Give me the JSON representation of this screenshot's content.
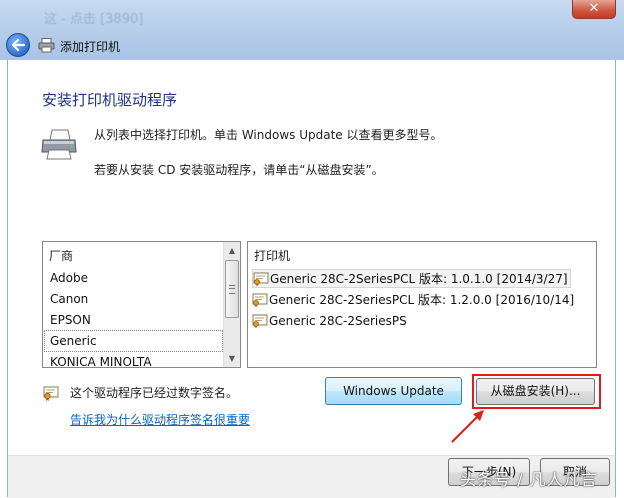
{
  "window": {
    "blurred_title": "这 - 点击 [3890]",
    "title": "添加打印机",
    "close_glyph": "✕"
  },
  "page": {
    "heading": "安装打印机驱动程序",
    "instruction_1": "从列表中选择打印机。单击 Windows Update 以查看更多型号。",
    "instruction_2": "若要从安装 CD 安装驱动程序，请单击“从磁盘安装”。"
  },
  "manufacturer_list": {
    "header": "厂商",
    "items": [
      "Adobe",
      "Canon",
      "EPSON",
      "Generic",
      "KONICA MINOLTA"
    ],
    "selected": "Generic"
  },
  "printer_list": {
    "header": "打印机",
    "items": [
      "Generic 28C-2SeriesPCL 版本: 1.0.1.0 [2014/3/27]",
      "Generic 28C-2SeriesPCL 版本: 1.2.0.0 [2016/10/14]",
      "Generic 28C-2SeriesPS"
    ],
    "selected": "Generic 28C-2SeriesPCL 版本: 1.0.1.0 [2014/3/27]"
  },
  "signature": {
    "text": "这个驱动程序已经过数字签名。",
    "link": "告诉我为什么驱动程序签名很重要"
  },
  "buttons": {
    "windows_update": "Windows Update",
    "have_disk": "从磁盘安装(H)...",
    "next": "下一步(N)",
    "cancel": "取消"
  },
  "watermark": "头条号 / 凡人凡言",
  "colors": {
    "heading": "#1e3287",
    "link": "#0066cc",
    "highlight": "#e21b1b"
  },
  "icons": {
    "back": "back-arrow-icon",
    "printer": "printer-icon",
    "certificate": "certificate-icon"
  }
}
